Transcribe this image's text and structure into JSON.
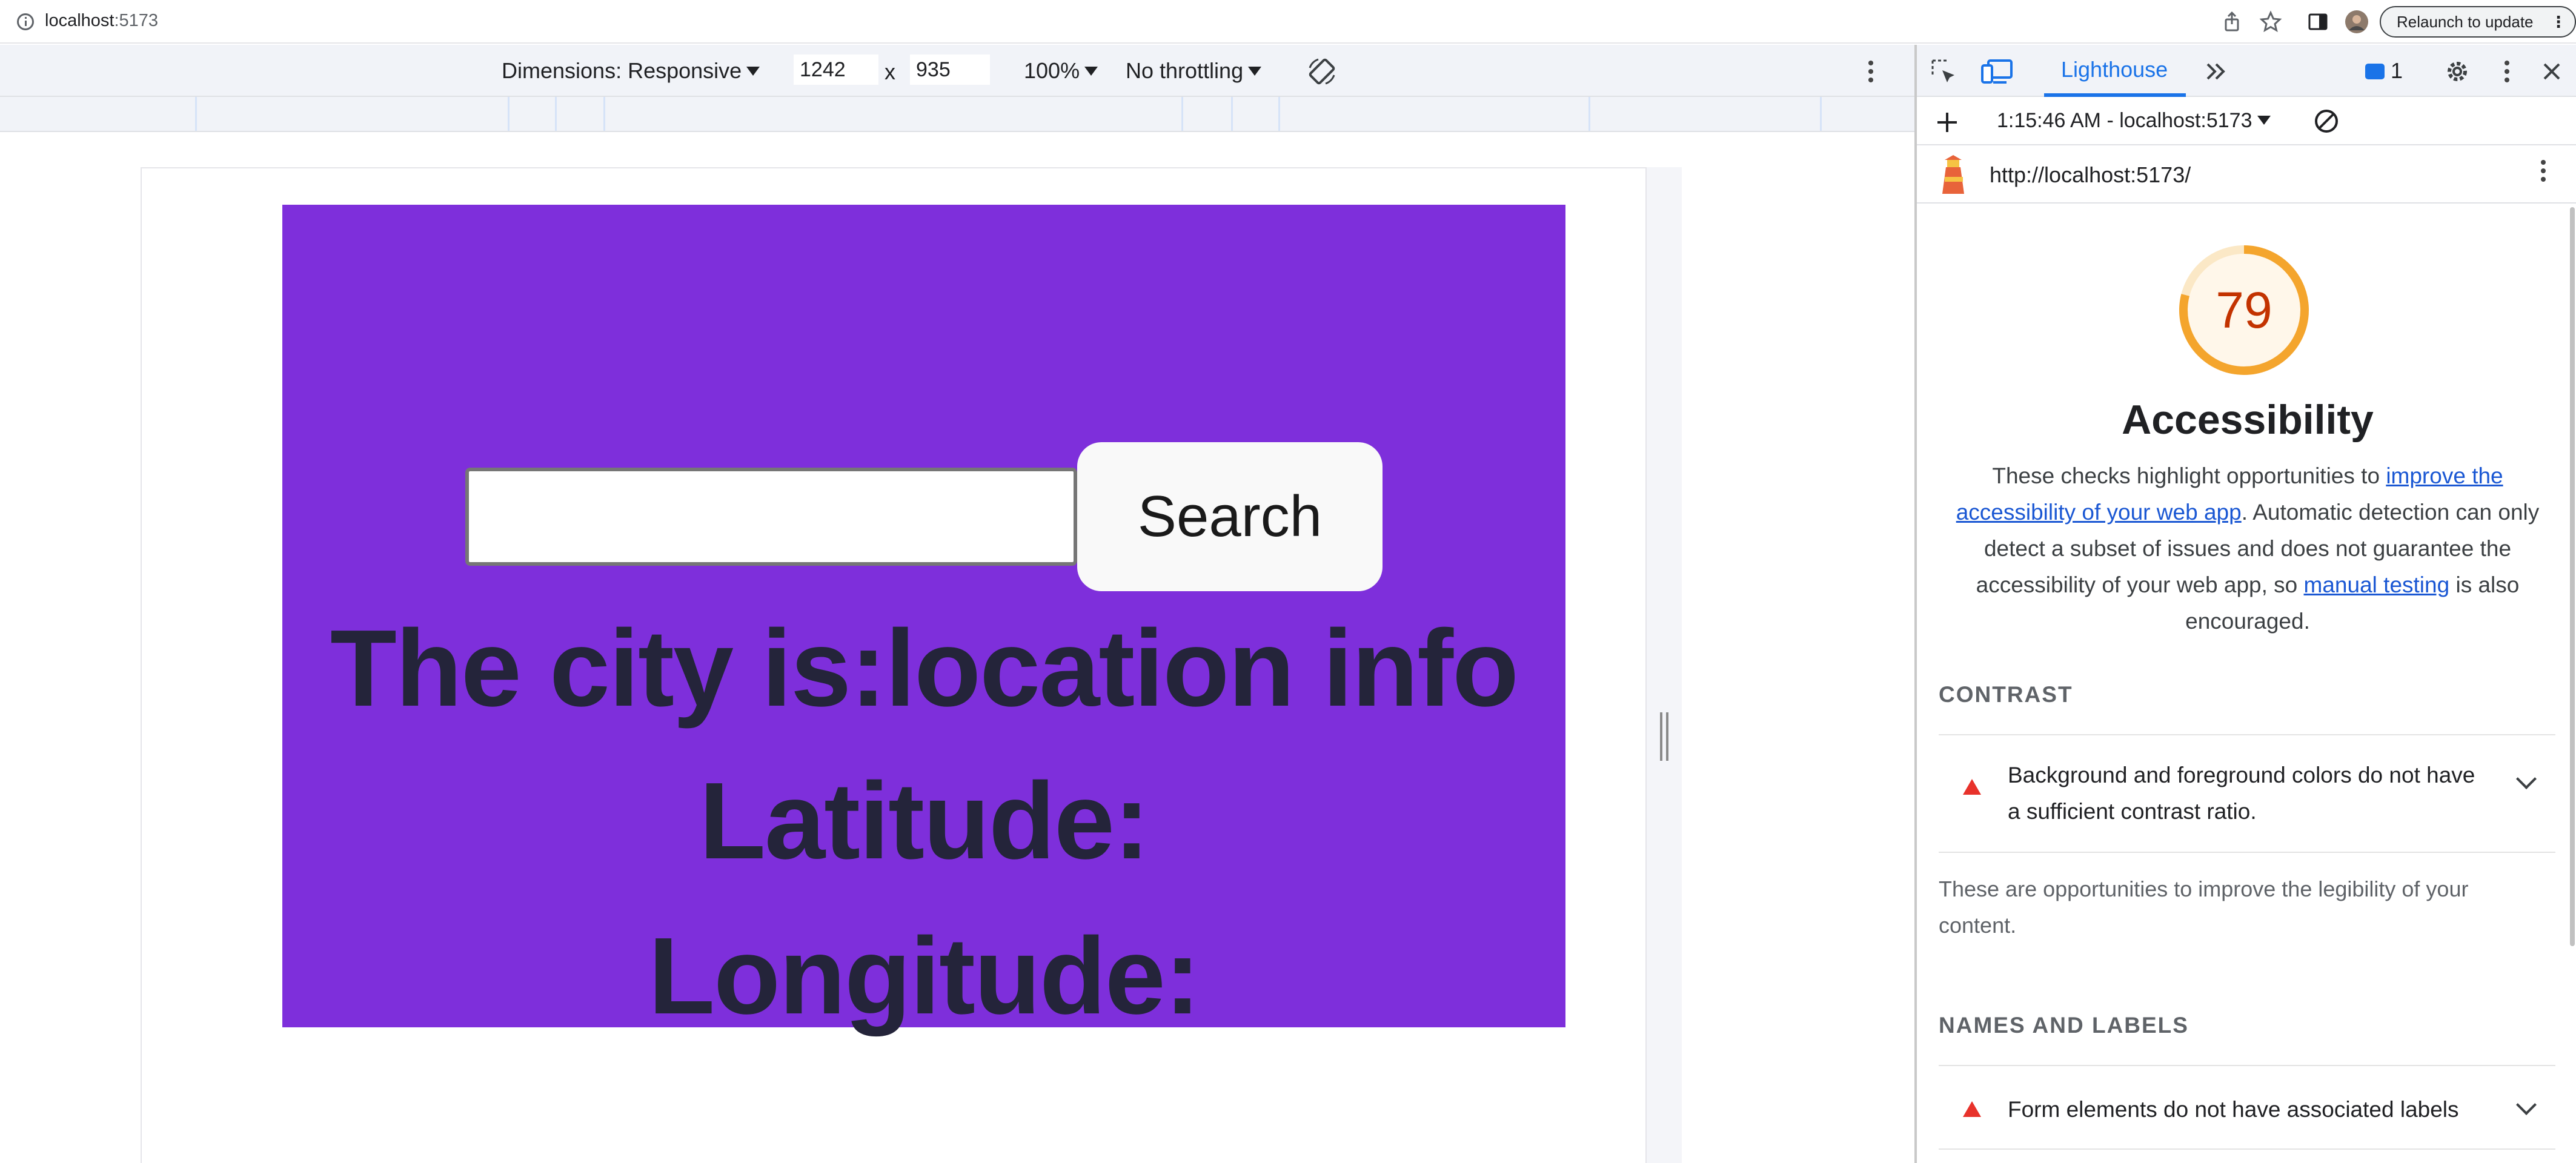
{
  "address_bar": {
    "host": "localhost",
    "port": ":5173",
    "relaunch_label": "Relaunch to update"
  },
  "device_toolbar": {
    "dimensions_label": "Dimensions: Responsive",
    "width_value": "1242",
    "times": "x",
    "height_value": "935",
    "zoom": "100%",
    "throttling": "No throttling"
  },
  "page": {
    "search_button": "Search",
    "city_line": "The city is:location info",
    "latitude_line": "Latitude:",
    "longitude_line": "Longitude:"
  },
  "devtools": {
    "tab": "Lighthouse",
    "issues_count": "1",
    "run_label": "1:15:46 AM - localhost:5173",
    "report_url": "http://localhost:5173/",
    "score": "79",
    "score_fraction": 0.79,
    "score_color": "#f4a52d",
    "category_title": "Accessibility",
    "desc_1": "These checks highlight opportunities to ",
    "desc_link_1": "improve the accessibility of your web app",
    "desc_2": ". Automatic detection can only detect a subset of issues and does not guarantee the accessibility of your web app, so ",
    "desc_link_2": "manual testing",
    "desc_3": " is also encouraged.",
    "groups": [
      {
        "title": "CONTRAST",
        "audit": "Background and foreground colors do not have a sufficient contrast ratio.",
        "description": "These are opportunities to improve the legibility of your content."
      },
      {
        "title": "NAMES AND LABELS",
        "audit": "Form elements do not have associated labels"
      }
    ]
  }
}
